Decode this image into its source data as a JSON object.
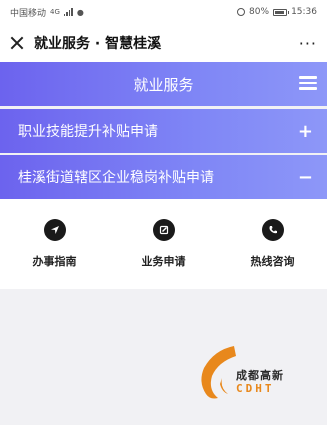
{
  "status_bar": {
    "carrier": "中国移动",
    "network": "4G",
    "battery_percent": "80%",
    "time": "15:36"
  },
  "title_bar": {
    "title": "就业服务 · 智慧桂溪",
    "more": "···"
  },
  "header": {
    "title": "就业服务"
  },
  "accordion": [
    {
      "label": "职业技能提升补贴申请",
      "toggle": "+"
    },
    {
      "label": "桂溪街道辖区企业稳岗补贴申请",
      "toggle": "−"
    }
  ],
  "submenu": [
    {
      "label": "办事指南",
      "icon": "navigation-arrow-icon"
    },
    {
      "label": "业务申请",
      "icon": "edit-pencil-icon"
    },
    {
      "label": "热线咨询",
      "icon": "phone-call-icon"
    }
  ],
  "logo": {
    "cn": "成都高新",
    "en": "CDHT",
    "color": "#e8881c"
  }
}
